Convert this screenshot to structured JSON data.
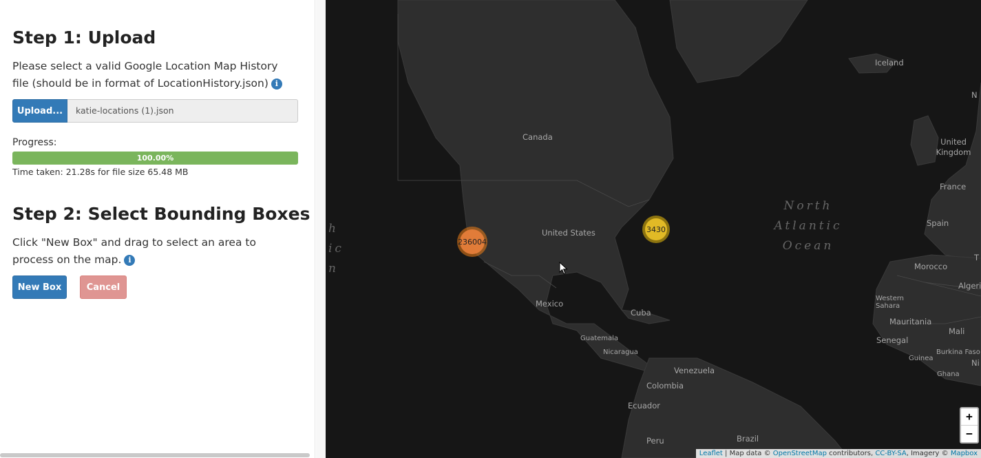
{
  "sidebar": {
    "step1": {
      "title": "Step 1: Upload",
      "description": "Please select a valid Google Location Map History file (should be in format of LocationHistory.json)",
      "upload_label": "Upload...",
      "file_name": "katie-locations (1).json",
      "progress_label": "Progress:",
      "progress_value": 1.0,
      "progress_text": "100.00%",
      "time_taken": "Time taken: 21.28s for file size 65.48 MB"
    },
    "step2": {
      "title": "Step 2: Select Bounding Boxes",
      "description": "Click \"New Box\" and drag to select an area to process on the map.",
      "new_box_label": "New Box",
      "cancel_label": "Cancel"
    },
    "info_icon": "info-circle-icon"
  },
  "map": {
    "labels": {
      "canada": "Canada",
      "united_states": "United States",
      "mexico": "Mexico",
      "cuba": "Cuba",
      "guatemala": "Guatemala",
      "nicaragua": "Nicaragua",
      "venezuela": "Venezuela",
      "colombia": "Colombia",
      "ecuador": "Ecuador",
      "peru": "Peru",
      "brazil": "Brazil",
      "iceland": "Iceland",
      "united_kingdom": "United Kingdom",
      "france": "France",
      "spain": "Spain",
      "morocco": "Morocco",
      "algeria": "Algeria",
      "western_sahara": "Western Sahara",
      "mauritania": "Mauritania",
      "mali": "Mali",
      "senegal": "Senegal",
      "burkina_faso": "Burkina Faso",
      "guinea": "Guinea",
      "ghana": "Ghana",
      "north_atlantic_ocean": "North Atlantic Ocean",
      "pacific_partial": "h\nic\nn",
      "edge_n": "N",
      "edge_t": "T",
      "edge_n2": "Ni"
    },
    "clusters": [
      {
        "count": "236004",
        "color": "#e9803c"
      },
      {
        "count": "3430",
        "color": "#e6be28"
      }
    ],
    "zoom_in_label": "+",
    "zoom_out_label": "−",
    "attribution": {
      "leaflet": "Leaflet",
      "map_data": " | Map data © ",
      "osm": "OpenStreetMap",
      "contributors": " contributors, ",
      "license": "CC-BY-SA",
      "imagery": ", Imagery © ",
      "mapbox": "Mapbox"
    },
    "colors": {
      "land": "#2e2e2e",
      "water": "#161616",
      "borders": "#4a4a4a"
    }
  }
}
